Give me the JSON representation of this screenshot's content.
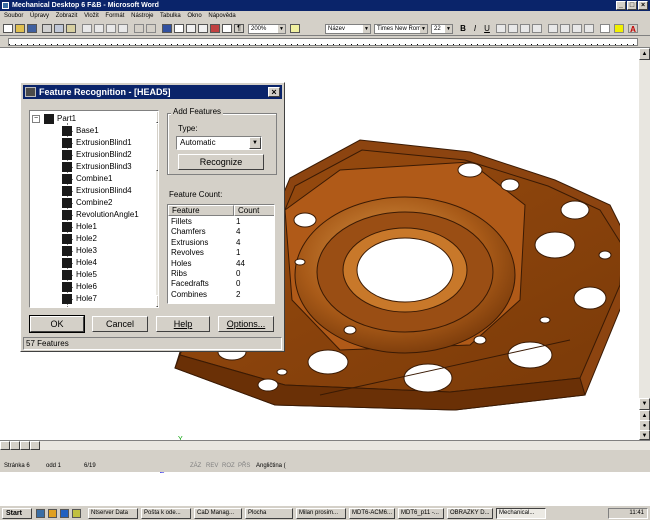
{
  "window": {
    "title": "Mechanical Desktop 6 F&B - Microsoft Word"
  },
  "menu": [
    "Soubor",
    "Úpravy",
    "Zobrazit",
    "Vložit",
    "Formát",
    "Nástroje",
    "Tabulka",
    "Okno",
    "Nápověda"
  ],
  "toolbar": {
    "zoom": "200%",
    "style": "Název",
    "font": "Times New Roman",
    "size": "22"
  },
  "dialog": {
    "title": "Feature Recognition - [HEAD5]",
    "tree_root": "Part1",
    "tree_items": [
      "Base1",
      "ExtrusionBlind1",
      "ExtrusionBlind2",
      "ExtrusionBlind3",
      "Combine1",
      "ExtrusionBlind4",
      "Combine2",
      "RevolutionAngle1",
      "Hole1",
      "Hole2",
      "Hole3",
      "Hole4",
      "Hole5",
      "Hole6",
      "Hole7"
    ],
    "add_features_label": "Add Features",
    "type_label": "Type:",
    "type_value": "Automatic",
    "recognize_label": "Recognize",
    "feature_count_label": "Feature Count:",
    "col_feature": "Feature",
    "col_count": "Count",
    "counts": [
      {
        "name": "Fillets",
        "count": "1"
      },
      {
        "name": "Chamfers",
        "count": "4"
      },
      {
        "name": "Extrusions",
        "count": "4"
      },
      {
        "name": "Revolves",
        "count": "1"
      },
      {
        "name": "Holes",
        "count": "44"
      },
      {
        "name": "Ribs",
        "count": "0"
      },
      {
        "name": "Facedrafts",
        "count": "0"
      },
      {
        "name": "Combines",
        "count": "2"
      }
    ],
    "ok_label": "OK",
    "cancel_label": "Cancel",
    "help_label": "Help",
    "options_label": "Options...",
    "status": "57 Features"
  },
  "triad": {
    "x": "X",
    "y": "Y",
    "z": "Z"
  },
  "statusbar": {
    "page": "Stránka 6",
    "section": "odd 1",
    "pages": "6/19",
    "flags": [
      "ZÁZ",
      "REV",
      "ROZ",
      "PŘS"
    ],
    "lang": "Angličtina ("
  },
  "taskbar": {
    "start": "Start",
    "items": [
      "Ntserver Data",
      "Pošta k ode...",
      "CaD Manag...",
      "Plocha",
      "Milan prosim...",
      "MDT6-ACM6...",
      "MDT6_p11 -...",
      "OBRAZKY D...",
      "Mechanical..."
    ],
    "clock": "11:41"
  },
  "colors": {
    "part": "#a0520f",
    "titlebar": "#0a246a",
    "face": "#d4d0c8"
  }
}
